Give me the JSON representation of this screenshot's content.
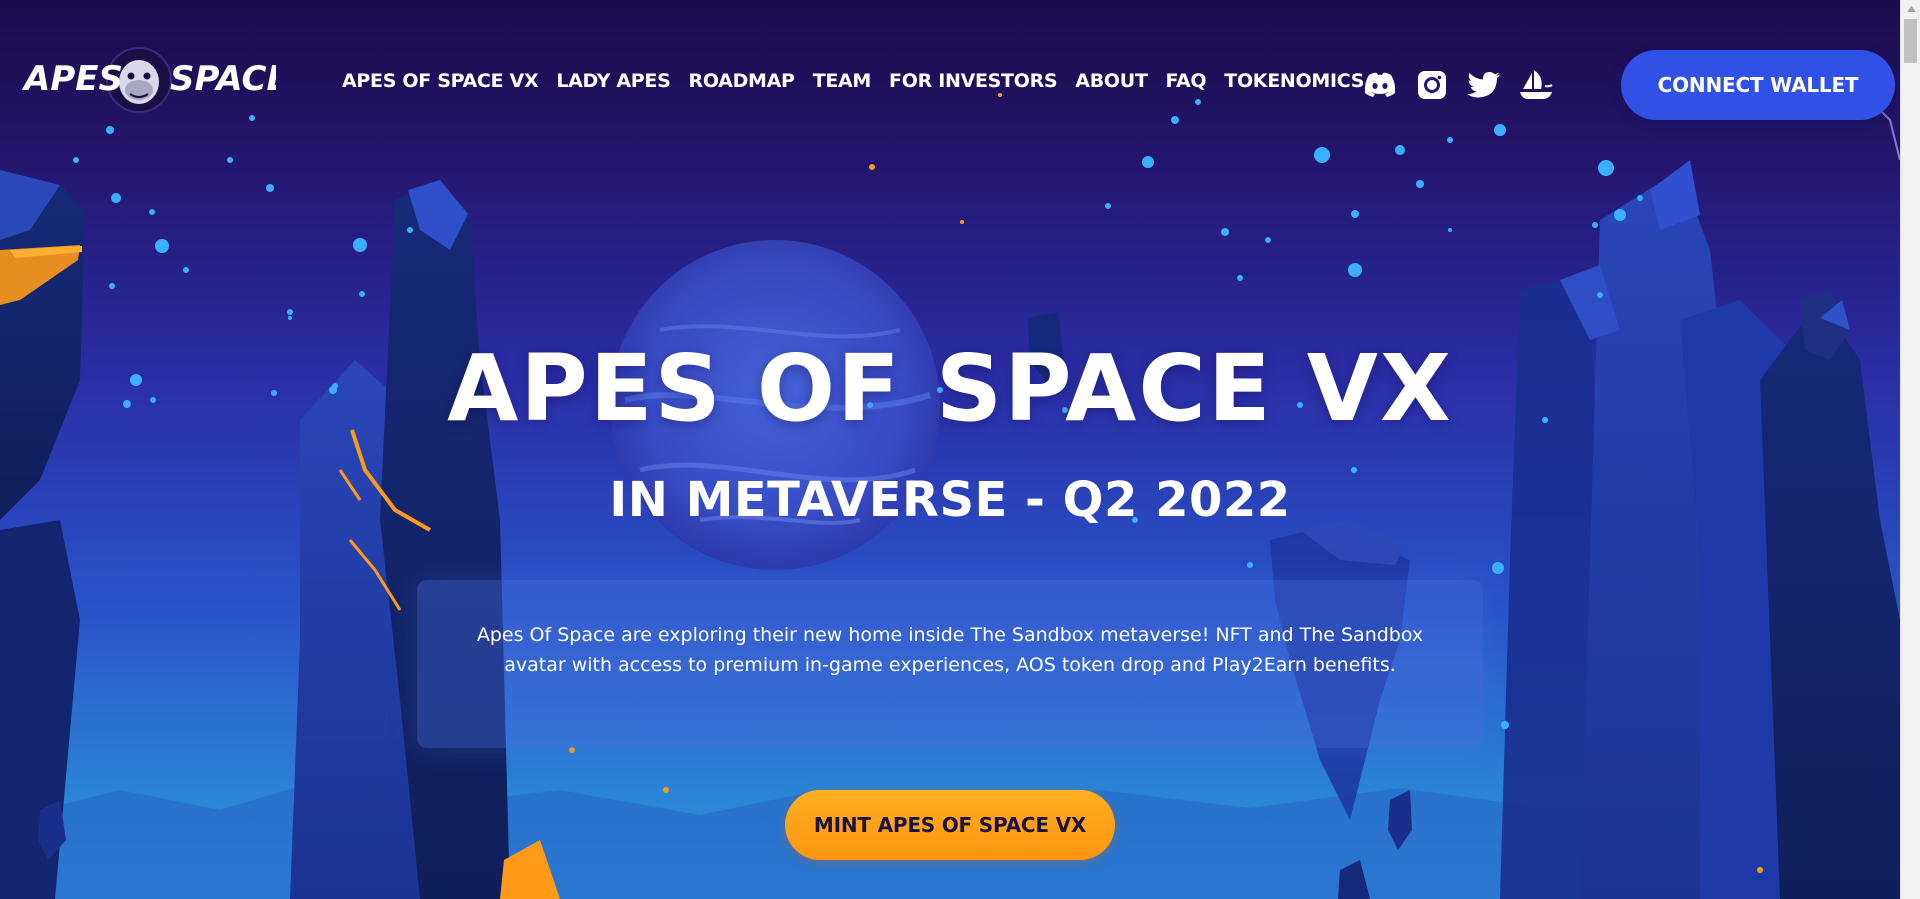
{
  "brand": {
    "logo_text": "APES SPACE",
    "logo_alt": "Apes Of Space logo"
  },
  "nav": {
    "items": [
      {
        "label": "APES OF SPACE VX"
      },
      {
        "label": "LADY APES"
      },
      {
        "label": "ROADMAP"
      },
      {
        "label": "TEAM"
      },
      {
        "label": "FOR INVESTORS"
      },
      {
        "label": "ABOUT"
      },
      {
        "label": "FAQ"
      },
      {
        "label": "TOKENOMICS"
      }
    ]
  },
  "socials": [
    {
      "icon": "discord-icon"
    },
    {
      "icon": "instagram-icon"
    },
    {
      "icon": "twitter-icon"
    },
    {
      "icon": "opensea-icon"
    }
  ],
  "header": {
    "connect_label": "CONNECT WALLET"
  },
  "hero": {
    "title": "APES OF SPACE VX",
    "subtitle": "IN METAVERSE - Q2 2022",
    "description": "Apes Of Space are exploring their new home inside The Sandbox metaverse! NFT and The Sandbox avatar with access to premium in-game experiences, AOS token drop and Play2Earn benefits.",
    "cta_label": "MINT APES OF SPACE VX"
  },
  "colors": {
    "connect_button": "#3050e6",
    "mint_button": "#ffa418",
    "background_top": "#1c0b4a",
    "background_bottom": "#2f98e0"
  }
}
